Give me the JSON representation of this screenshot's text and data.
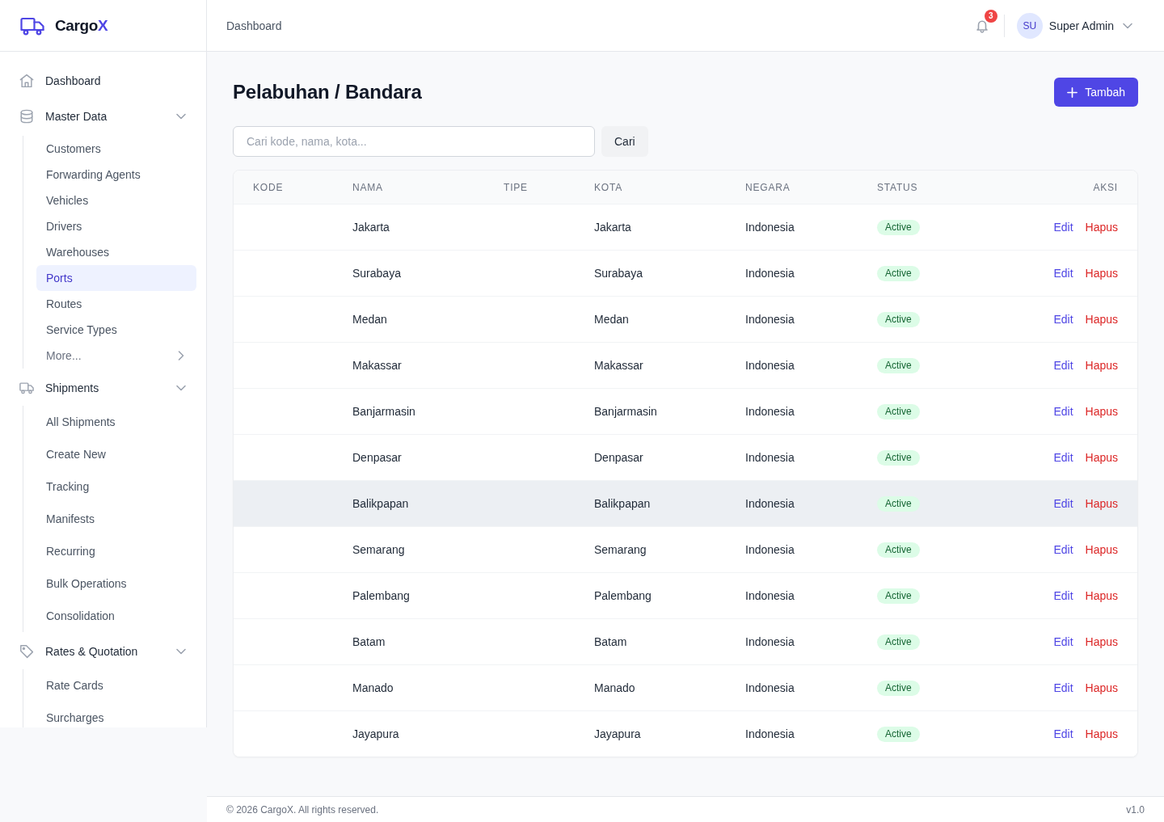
{
  "sidebar": {
    "logo": {
      "text": "Cargo",
      "accent": "X"
    },
    "nav": [
      {
        "kind": "link",
        "label": "Dashboard",
        "selected": false
      },
      {
        "kind": "group",
        "label": "Master Data",
        "selected": false,
        "expanded": true,
        "compact": true,
        "children": [
          {
            "kind": "link",
            "label": "Customers",
            "selected": false
          },
          {
            "kind": "link",
            "label": "Forwarding Agents",
            "selected": false
          },
          {
            "kind": "link",
            "label": "Vehicles",
            "selected": false
          },
          {
            "kind": "link",
            "label": "Drivers",
            "selected": false
          },
          {
            "kind": "link",
            "label": "Warehouses",
            "selected": false
          },
          {
            "kind": "link",
            "label": "Ports",
            "selected": true
          },
          {
            "kind": "link",
            "label": "Routes",
            "selected": false
          },
          {
            "kind": "link",
            "label": "Service Types",
            "selected": false
          },
          {
            "kind": "more",
            "label": "More...",
            "selected": false
          }
        ]
      },
      {
        "kind": "group",
        "label": "Shipments",
        "selected": false,
        "expanded": true,
        "compact": false,
        "children": [
          {
            "kind": "link",
            "label": "All Shipments",
            "selected": false
          },
          {
            "kind": "link",
            "label": "Create New",
            "selected": false
          },
          {
            "kind": "link",
            "label": "Tracking",
            "selected": false
          },
          {
            "kind": "link",
            "label": "Manifests",
            "selected": false
          },
          {
            "kind": "link",
            "label": "Recurring",
            "selected": false
          },
          {
            "kind": "link",
            "label": "Bulk Operations",
            "selected": false
          },
          {
            "kind": "link",
            "label": "Consolidation",
            "selected": false
          }
        ]
      },
      {
        "kind": "group",
        "label": "Rates & Quotation",
        "selected": false,
        "expanded": true,
        "compact": false,
        "children": [
          {
            "kind": "link",
            "label": "Rate Cards",
            "selected": false
          },
          {
            "kind": "link",
            "label": "Surcharges",
            "selected": false
          }
        ]
      }
    ]
  },
  "header": {
    "breadcrumb": "Dashboard",
    "notifications": {
      "count": "3"
    },
    "user": {
      "initials": "SU",
      "name": "Super Admin"
    }
  },
  "page": {
    "title": "Pelabuhan / Bandara",
    "add_button": "Tambah",
    "search": {
      "placeholder": "Cari kode, nama, kota...",
      "button": "Cari"
    }
  },
  "table": {
    "columns": [
      "KODE",
      "NAMA",
      "TIPE",
      "KOTA",
      "NEGARA",
      "STATUS",
      "AKSI"
    ],
    "rows": [
      {
        "nama": "Jakarta",
        "kota": "Jakarta",
        "negara": "Indonesia",
        "status": "Active",
        "edit": "Edit",
        "delete": "Hapus",
        "hovered": false
      },
      {
        "nama": "Surabaya",
        "kota": "Surabaya",
        "negara": "Indonesia",
        "status": "Active",
        "edit": "Edit",
        "delete": "Hapus",
        "hovered": false
      },
      {
        "nama": "Medan",
        "kota": "Medan",
        "negara": "Indonesia",
        "status": "Active",
        "edit": "Edit",
        "delete": "Hapus",
        "hovered": false
      },
      {
        "nama": "Makassar",
        "kota": "Makassar",
        "negara": "Indonesia",
        "status": "Active",
        "edit": "Edit",
        "delete": "Hapus",
        "hovered": false
      },
      {
        "nama": "Banjarmasin",
        "kota": "Banjarmasin",
        "negara": "Indonesia",
        "status": "Active",
        "edit": "Edit",
        "delete": "Hapus",
        "hovered": false
      },
      {
        "nama": "Denpasar",
        "kota": "Denpasar",
        "negara": "Indonesia",
        "status": "Active",
        "edit": "Edit",
        "delete": "Hapus",
        "hovered": false
      },
      {
        "nama": "Balikpapan",
        "kota": "Balikpapan",
        "negara": "Indonesia",
        "status": "Active",
        "edit": "Edit",
        "delete": "Hapus",
        "hovered": true
      },
      {
        "nama": "Semarang",
        "kota": "Semarang",
        "negara": "Indonesia",
        "status": "Active",
        "edit": "Edit",
        "delete": "Hapus",
        "hovered": false
      },
      {
        "nama": "Palembang",
        "kota": "Palembang",
        "negara": "Indonesia",
        "status": "Active",
        "edit": "Edit",
        "delete": "Hapus",
        "hovered": false
      },
      {
        "nama": "Batam",
        "kota": "Batam",
        "negara": "Indonesia",
        "status": "Active",
        "edit": "Edit",
        "delete": "Hapus",
        "hovered": false
      },
      {
        "nama": "Manado",
        "kota": "Manado",
        "negara": "Indonesia",
        "status": "Active",
        "edit": "Edit",
        "delete": "Hapus",
        "hovered": false
      },
      {
        "nama": "Jayapura",
        "kota": "Jayapura",
        "negara": "Indonesia",
        "status": "Active",
        "edit": "Edit",
        "delete": "Hapus",
        "hovered": false
      }
    ]
  },
  "footer": {
    "copyright": "© 2026 CargoX. All rights reserved.",
    "version": "v1.0"
  }
}
